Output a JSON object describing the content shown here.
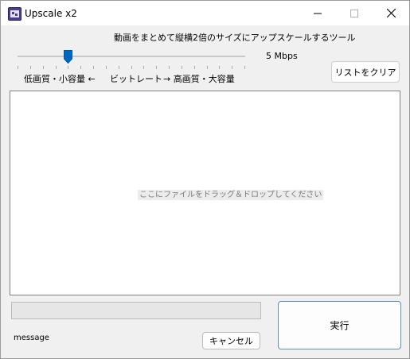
{
  "window": {
    "title": "Upscale x2"
  },
  "header": {
    "subtitle": "動画をまとめて縦横2倍のサイズにアップスケールするツール"
  },
  "slider": {
    "value_label": "5 Mbps",
    "low_label": "低画質・小容量 ←",
    "mid_label": "ビットレート",
    "high_label": "→ 高画質・大容量",
    "position_fraction": 0.222
  },
  "buttons": {
    "clear_list": "リストをクリア",
    "cancel": "キャンセル",
    "run": "実行"
  },
  "dropzone": {
    "hint": "ここにファイルをドラッグ＆ドロップしてください"
  },
  "status": {
    "message": "message",
    "progress": 0
  },
  "icons": {
    "app": "app-icon",
    "minimize": "minimize-icon",
    "maximize": "maximize-icon",
    "close": "close-icon"
  },
  "colors": {
    "accent": "#0067c0",
    "progress_fill": "#06b025"
  }
}
